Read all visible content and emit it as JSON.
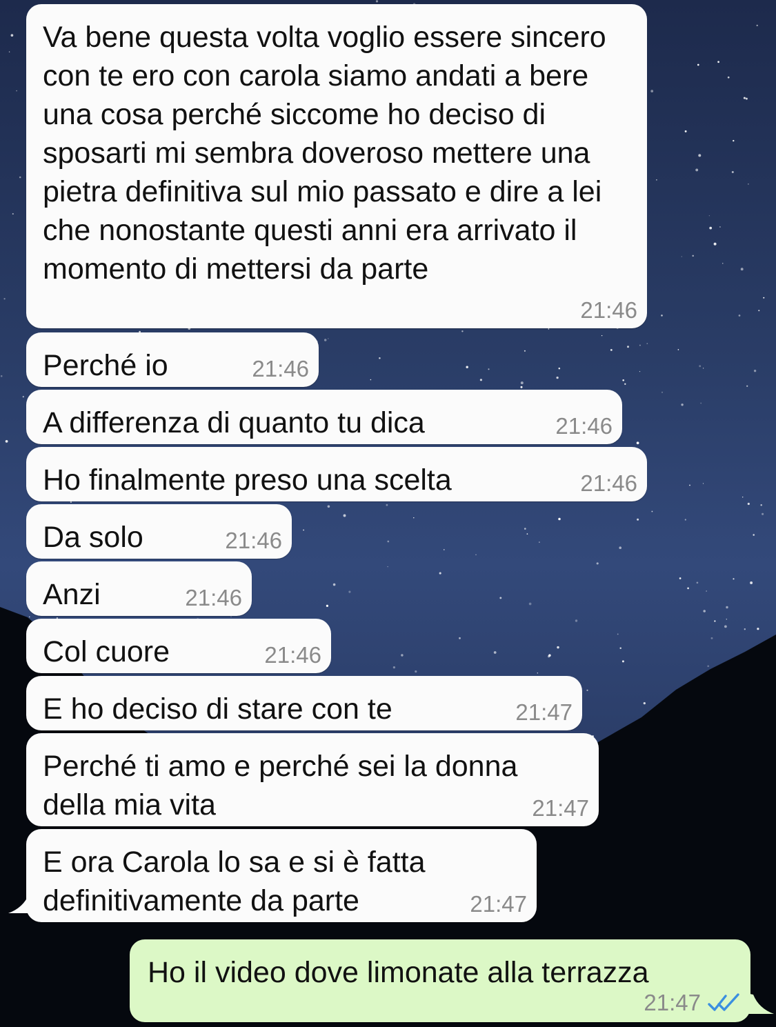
{
  "chat": {
    "messages": [
      {
        "direction": "incoming",
        "text": "Va bene questa volta voglio essere sincero con te ero con carola siamo andati a bere una cosa perché siccome ho deciso di sposarti mi sembra doveroso mettere una pietra definitiva sul mio passato e dire a lei che nonostante questi anni era arrivato il momento di mettersi da parte",
        "time": "21:46"
      },
      {
        "direction": "incoming",
        "text": "Perché io",
        "time": "21:46"
      },
      {
        "direction": "incoming",
        "text": "A differenza di quanto tu dica",
        "time": "21:46"
      },
      {
        "direction": "incoming",
        "text": "Ho finalmente preso una scelta",
        "time": "21:46"
      },
      {
        "direction": "incoming",
        "text": "Da solo",
        "time": "21:46"
      },
      {
        "direction": "incoming",
        "text": "Anzi",
        "time": "21:46"
      },
      {
        "direction": "incoming",
        "text": "Col cuore",
        "time": "21:46"
      },
      {
        "direction": "incoming",
        "text": "E ho deciso di stare con te",
        "time": "21:47"
      },
      {
        "direction": "incoming",
        "text": "Perché ti amo e perché sei la donna della mia vita",
        "time": "21:47"
      },
      {
        "direction": "incoming",
        "text": "E ora Carola lo sa e si è fatta definitivamente da parte",
        "time": "21:47"
      },
      {
        "direction": "outgoing",
        "text": "Ho il video dove limonate alla terrazza",
        "time": "21:47",
        "status_icon": "double-check-read-icon"
      }
    ]
  },
  "colors": {
    "incoming_bubble": "#fbfbfb",
    "outgoing_bubble": "#dcf8c6",
    "timestamp": "#8a8a8a",
    "read_ticks": "#3b8fe0"
  },
  "background": "starry-night-sky-wallpaper"
}
